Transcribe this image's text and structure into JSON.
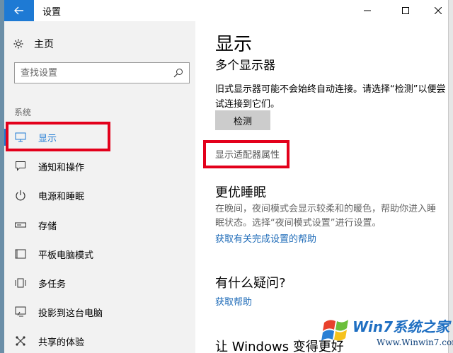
{
  "window": {
    "title": "设置"
  },
  "nav": {
    "home_label": "主页",
    "search_placeholder": "查找设置",
    "section_label": "系统",
    "items": [
      {
        "label": "显示",
        "icon": "monitor-icon",
        "active": true
      },
      {
        "label": "通知和操作",
        "icon": "message-icon"
      },
      {
        "label": "电源和睡眠",
        "icon": "power-icon"
      },
      {
        "label": "存储",
        "icon": "storage-icon"
      },
      {
        "label": "平板电脑模式",
        "icon": "tablet-icon"
      },
      {
        "label": "多任务",
        "icon": "multitask-icon"
      },
      {
        "label": "投影到这台电脑",
        "icon": "project-icon"
      },
      {
        "label": "共享的体验",
        "icon": "share-icon"
      }
    ]
  },
  "content": {
    "title": "显示",
    "subtitle": "多个显示器",
    "description": "旧式显示器可能不会始终自动连接。请选择“检测”以便尝试连接到它们。",
    "detect_button": "检测",
    "adapter_link": "显示适配器属性",
    "night_heading": "更优睡眠",
    "night_text": "在晚间，夜间模式会显示较柔和的暖色，帮助你进入睡眠状态。选择“夜间模式设置”进行设置。",
    "night_link": "获取有关完成设置的帮助",
    "question_heading": "有什么疑问?",
    "question_link": "获取帮助",
    "bottom_heading": "让 Windows 变得更好"
  },
  "watermark": {
    "title": "Win7系统之家",
    "url": "Www.Winwin7.com"
  },
  "colors": {
    "accent": "#1e7ad4",
    "highlight": "#e3001b"
  }
}
